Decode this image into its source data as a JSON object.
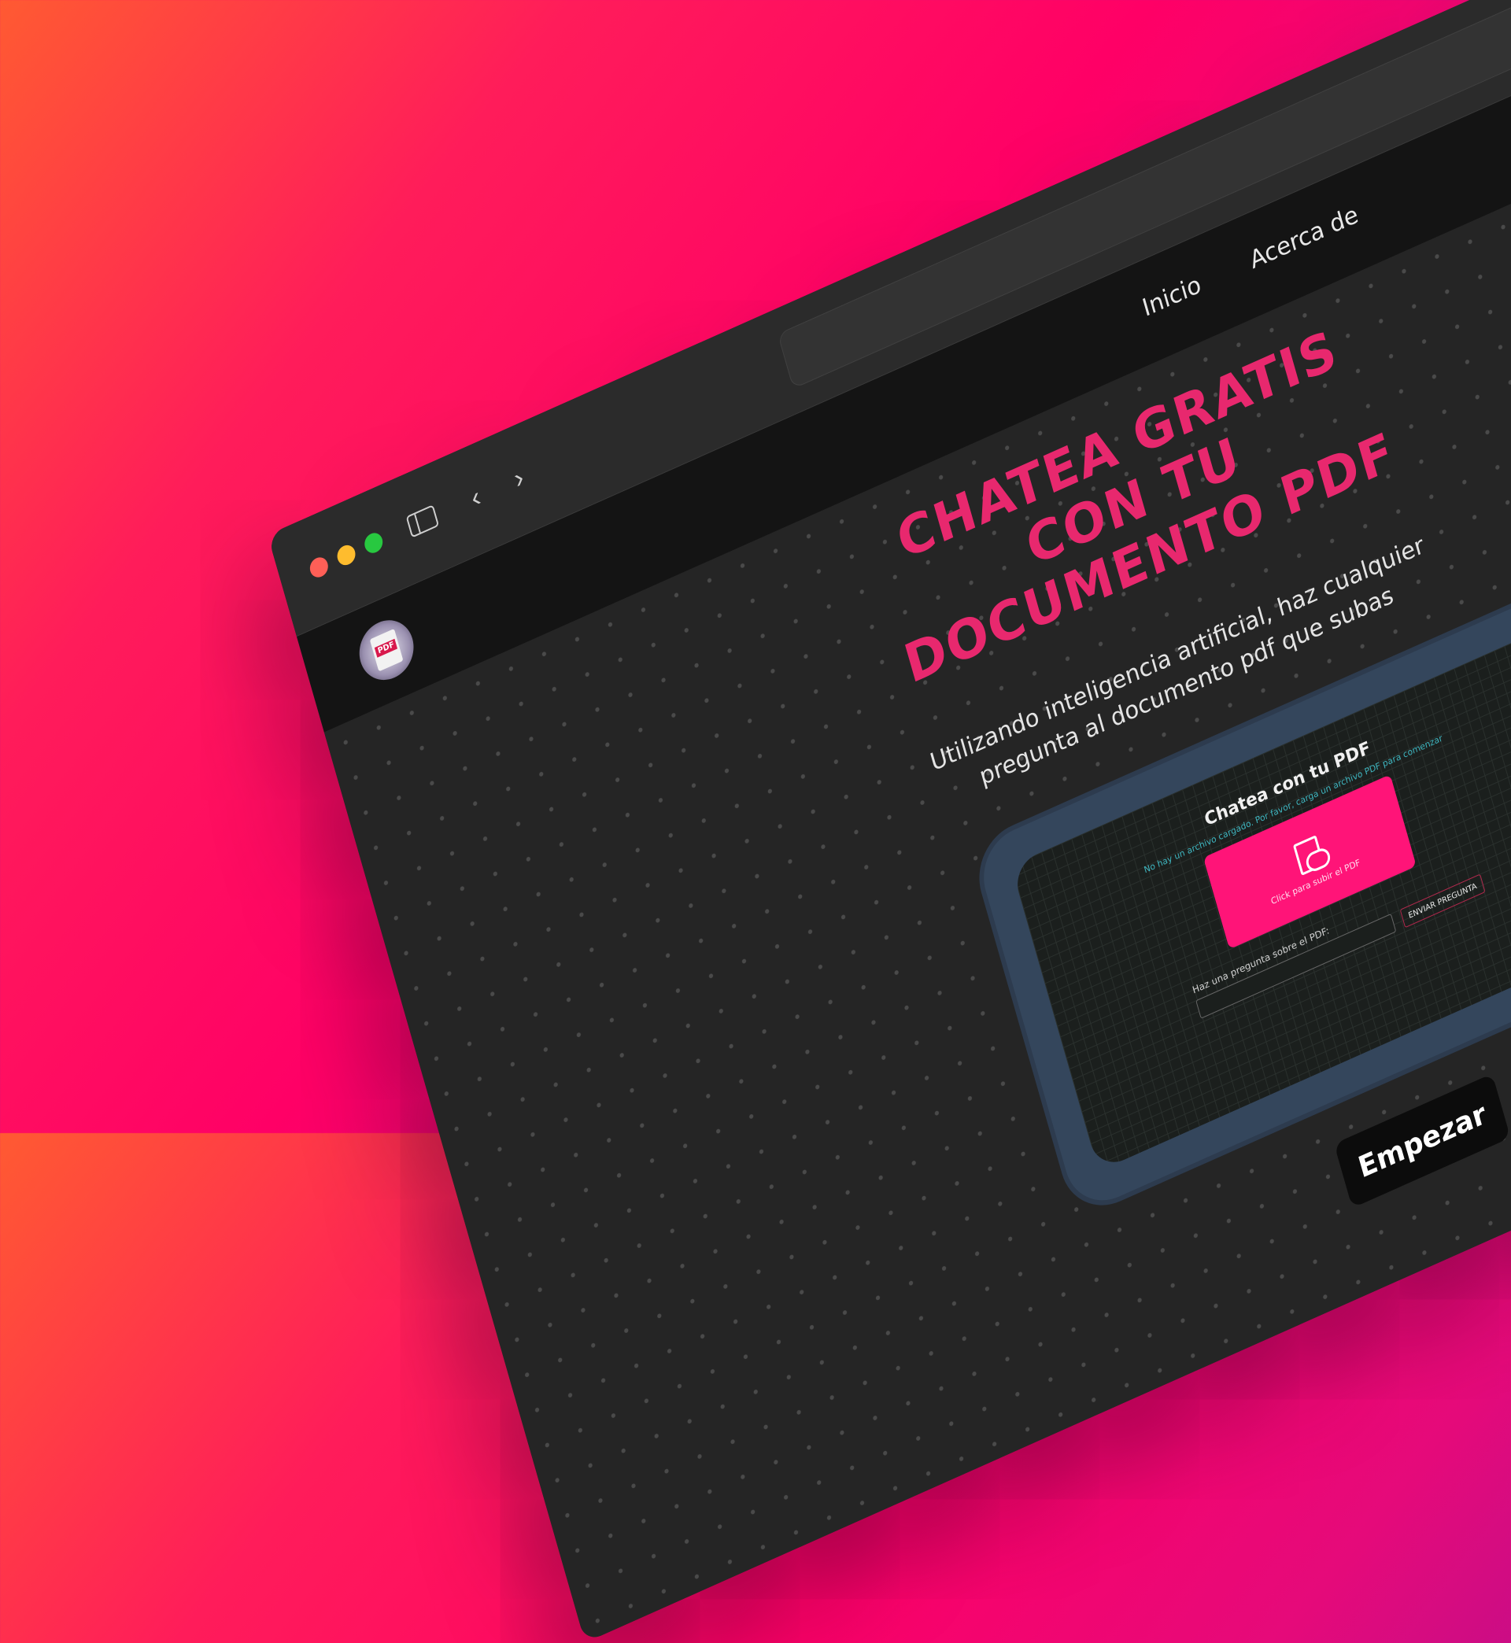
{
  "browser": {
    "back_glyph": "‹",
    "forward_glyph": "›",
    "reload_glyph": "↻"
  },
  "site": {
    "logo_badge": "PDF",
    "nav": {
      "home": "Inicio",
      "about": "Acerca de"
    }
  },
  "hero": {
    "title": "CHATEA GRATIS CON TU DOCUMENTO PDF",
    "subtitle": "Utilizando inteligencia artificial, haz cualquier pregunta al documento pdf que subas",
    "cta": "Empezar"
  },
  "preview": {
    "title": "Chatea con tu PDF",
    "notice": "No hay un archivo cargado. Por favor, carga un archivo PDF para comenzar",
    "upload_label": "Click para subir el PDF",
    "question_label": "Haz una pregunta sobre el PDF:",
    "send_label": "ENVIAR PREGUNTA"
  },
  "colors": {
    "accent": "#e8286e",
    "upload_button": "#ff1478",
    "page_background": "#252525",
    "nav_background": "#141414"
  },
  "icons": [
    "sidebar-icon",
    "back-arrow-icon",
    "forward-arrow-icon",
    "reload-icon",
    "logo-icon",
    "cloud-upload-icon"
  ]
}
